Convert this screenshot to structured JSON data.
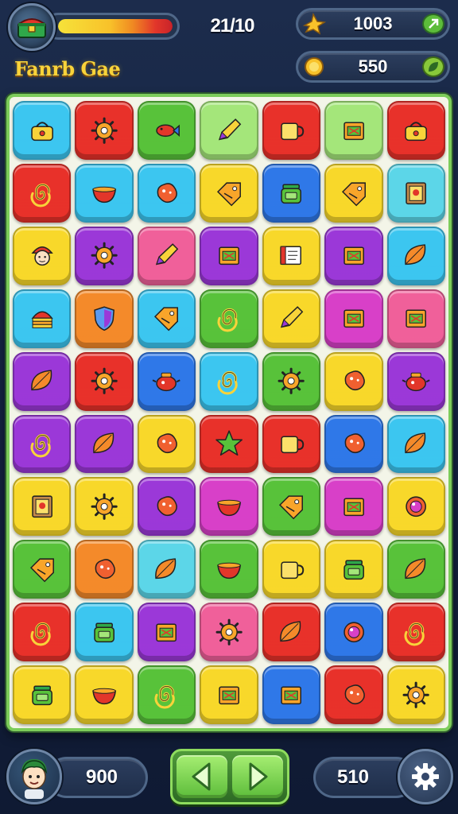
{
  "hud": {
    "moves": "21/10",
    "health_percent": 100,
    "score": "1003",
    "coins": "550",
    "title": "Fanrb Gae"
  },
  "bottom": {
    "left_value": "900",
    "right_value": "510"
  },
  "icons": {
    "avatar_top": "treasure-chest-icon",
    "score_left": "star-burst-icon",
    "score_right": "arrow-icon",
    "coin_left": "coin-icon",
    "coin_right": "leaf-badge-icon",
    "nav_left": "arrow-left-icon",
    "nav_right": "arrow-right-icon",
    "settings": "gear-icon"
  },
  "colors": {
    "cyan": "#3cc6f0",
    "red": "#e8312a",
    "green": "#58c23a",
    "lime": "#a4e67a",
    "yellow": "#f8d82a",
    "blue": "#2f78e8",
    "teal": "#5cd6e8",
    "pink": "#f0609a",
    "purple": "#9b38d8",
    "orange": "#f48a2a",
    "magenta": "#d840c8"
  },
  "board": {
    "rows": [
      [
        [
          "cyan",
          "bag"
        ],
        [
          "red",
          "gear"
        ],
        [
          "green",
          "fish"
        ],
        [
          "lime",
          "pencil"
        ],
        [
          "red",
          "mug"
        ],
        [
          "lime",
          "box"
        ],
        [
          "red",
          "bag"
        ]
      ],
      [
        [
          "red",
          "swirl"
        ],
        [
          "cyan",
          "bowl"
        ],
        [
          "cyan",
          "blob"
        ],
        [
          "yellow",
          "tag"
        ],
        [
          "blue",
          "jar"
        ],
        [
          "yellow",
          "tag"
        ],
        [
          "teal",
          "frame"
        ]
      ],
      [
        [
          "yellow",
          "face"
        ],
        [
          "purple",
          "gear"
        ],
        [
          "pink",
          "pencil"
        ],
        [
          "purple",
          "box"
        ],
        [
          "yellow",
          "book"
        ],
        [
          "purple",
          "box"
        ],
        [
          "cyan",
          "leaf"
        ]
      ],
      [
        [
          "cyan",
          "cake"
        ],
        [
          "orange",
          "shield"
        ],
        [
          "cyan",
          "tag"
        ],
        [
          "green",
          "swirl"
        ],
        [
          "yellow",
          "pencil"
        ],
        [
          "magenta",
          "box"
        ],
        [
          "pink",
          "box"
        ]
      ],
      [
        [
          "purple",
          "leaf"
        ],
        [
          "red",
          "gear"
        ],
        [
          "blue",
          "pot"
        ],
        [
          "cyan",
          "swirl"
        ],
        [
          "green",
          "gear"
        ],
        [
          "yellow",
          "blob"
        ],
        [
          "purple",
          "pot"
        ]
      ],
      [
        [
          "purple",
          "swirl"
        ],
        [
          "purple",
          "leaf"
        ],
        [
          "yellow",
          "blob"
        ],
        [
          "red",
          "star"
        ],
        [
          "red",
          "mug"
        ],
        [
          "blue",
          "blob"
        ],
        [
          "cyan",
          "leaf"
        ]
      ],
      [
        [
          "yellow",
          "frame"
        ],
        [
          "yellow",
          "gear"
        ],
        [
          "purple",
          "blob"
        ],
        [
          "magenta",
          "bowl"
        ],
        [
          "green",
          "tag"
        ],
        [
          "magenta",
          "box"
        ],
        [
          "yellow",
          "ring"
        ]
      ],
      [
        [
          "green",
          "tag"
        ],
        [
          "orange",
          "blob"
        ],
        [
          "teal",
          "leaf"
        ],
        [
          "green",
          "bowl"
        ],
        [
          "yellow",
          "mug"
        ],
        [
          "yellow",
          "jar"
        ],
        [
          "green",
          "leaf"
        ]
      ],
      [
        [
          "red",
          "swirl"
        ],
        [
          "cyan",
          "jar"
        ],
        [
          "purple",
          "box"
        ],
        [
          "pink",
          "gear"
        ],
        [
          "red",
          "leaf"
        ],
        [
          "blue",
          "ring"
        ],
        [
          "red",
          "swirl"
        ]
      ],
      [
        [
          "yellow",
          "jar"
        ],
        [
          "yellow",
          "bowl"
        ],
        [
          "green",
          "swirl"
        ],
        [
          "yellow",
          "box"
        ],
        [
          "blue",
          "box"
        ],
        [
          "red",
          "blob"
        ],
        [
          "yellow",
          "gear"
        ]
      ]
    ]
  }
}
